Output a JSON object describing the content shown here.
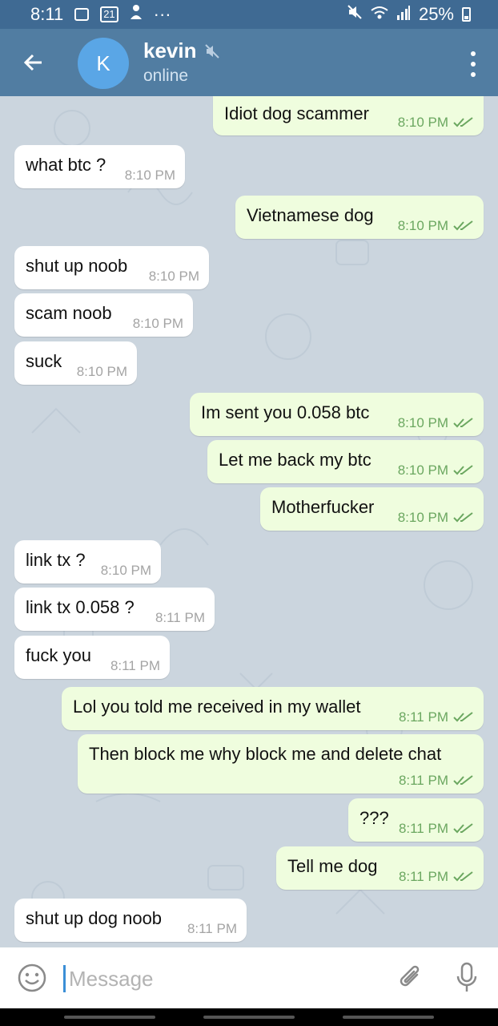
{
  "status_bar": {
    "time": "8:11",
    "notif_count": "21",
    "more": "···",
    "battery": "25%"
  },
  "header": {
    "avatar_letter": "K",
    "title": "kevin",
    "subtitle": "online"
  },
  "messages": [
    {
      "dir": "out",
      "text": "Idiot dog scammer",
      "time": "8:10 PM"
    },
    {
      "dir": "in",
      "text": "what btc ?",
      "time": "8:10 PM"
    },
    {
      "dir": "out",
      "text": "Vietnamese dog",
      "time": "8:10 PM"
    },
    {
      "dir": "in",
      "text": "shut up noob",
      "time": "8:10 PM"
    },
    {
      "dir": "in",
      "text": "scam noob",
      "time": "8:10 PM"
    },
    {
      "dir": "in",
      "text": "suck",
      "time": "8:10 PM"
    },
    {
      "dir": "out",
      "text": "Im sent you 0.058 btc",
      "time": "8:10 PM"
    },
    {
      "dir": "out",
      "text": "Let me back my btc",
      "time": "8:10 PM"
    },
    {
      "dir": "out",
      "text": "Motherfucker",
      "time": "8:10 PM"
    },
    {
      "dir": "in",
      "text": "link tx ?",
      "time": "8:10 PM"
    },
    {
      "dir": "in",
      "text": "link tx 0.058 ?",
      "time": "8:11 PM"
    },
    {
      "dir": "in",
      "text": "fuck you",
      "time": "8:11 PM"
    },
    {
      "dir": "out",
      "text": "Lol you told me received in my wallet",
      "time": "8:11 PM"
    },
    {
      "dir": "out",
      "text": "Then block me why block me and delete chat",
      "time": "8:11 PM"
    },
    {
      "dir": "out",
      "text": "???",
      "time": "8:11 PM"
    },
    {
      "dir": "out",
      "text": "Tell me dog",
      "time": "8:11 PM"
    },
    {
      "dir": "in",
      "text": "shut up dog noob",
      "time": "8:11 PM"
    }
  ],
  "input": {
    "placeholder": "Message",
    "value": ""
  },
  "colors": {
    "header": "#517da2",
    "status_bar": "#3f6a93",
    "chat_bg": "#cbd5de",
    "outgoing_bubble": "#effdde",
    "incoming_bubble": "#ffffff",
    "avatar": "#5aa6e6",
    "read_ticks": "#6ba760"
  },
  "icons": {
    "back": "arrow-left-icon",
    "muted": "muted-speaker-icon",
    "menu": "kebab-menu-icon",
    "emoji": "emoji-icon",
    "attach": "paperclip-icon",
    "mic": "microphone-icon",
    "read": "double-check-icon"
  }
}
